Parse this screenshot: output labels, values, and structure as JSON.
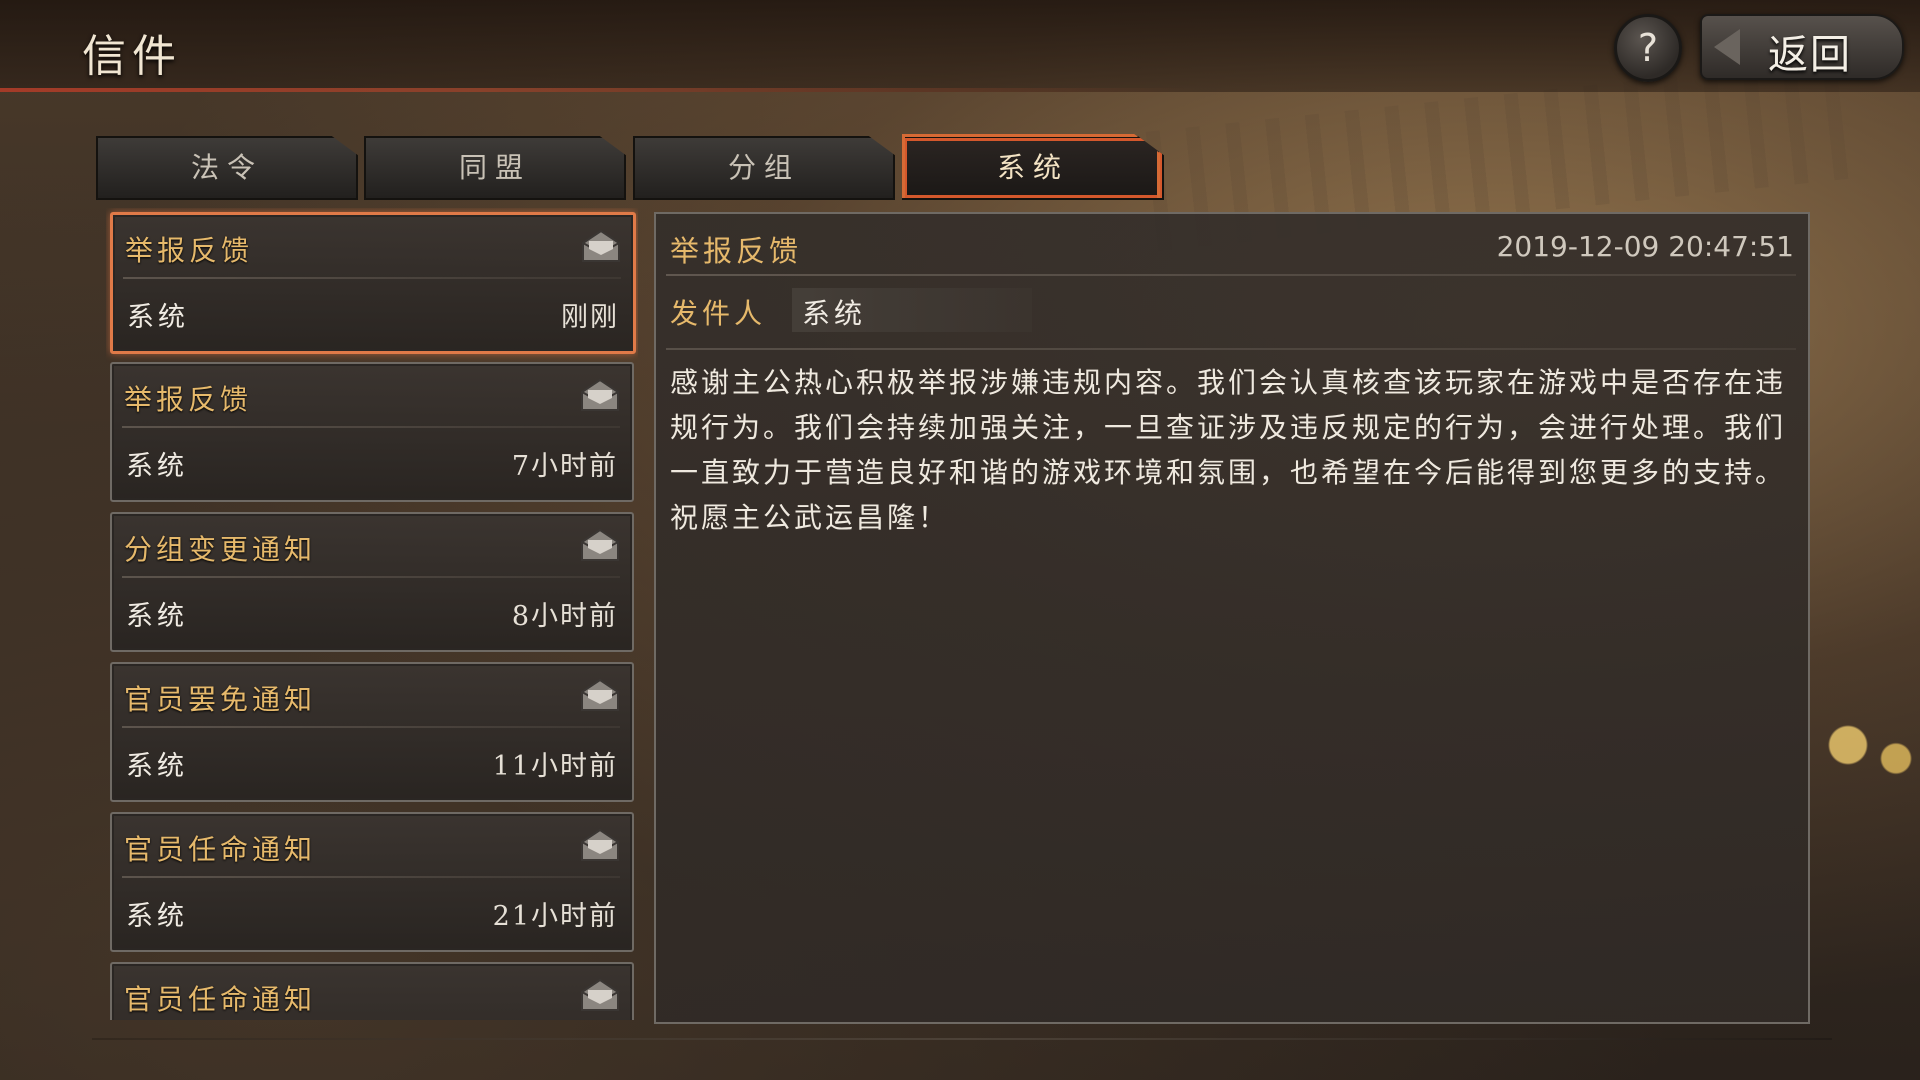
{
  "header": {
    "title": "信件",
    "help_label": "?",
    "back_label": "返回"
  },
  "tabs": [
    {
      "label": "法令",
      "active": false
    },
    {
      "label": "同盟",
      "active": false
    },
    {
      "label": "分组",
      "active": false
    },
    {
      "label": "系统",
      "active": true
    }
  ],
  "mail_list": [
    {
      "subject": "举报反馈",
      "sender": "系统",
      "time": "刚刚",
      "selected": true
    },
    {
      "subject": "举报反馈",
      "sender": "系统",
      "time": "7小时前",
      "selected": false
    },
    {
      "subject": "分组变更通知",
      "sender": "系统",
      "time": "8小时前",
      "selected": false
    },
    {
      "subject": "官员罢免通知",
      "sender": "系统",
      "time": "11小时前",
      "selected": false
    },
    {
      "subject": "官员任命通知",
      "sender": "系统",
      "time": "21小时前",
      "selected": false
    },
    {
      "subject": "官员任命通知",
      "sender": "",
      "time": "",
      "selected": false
    }
  ],
  "detail": {
    "title": "举报反馈",
    "date": "2019-12-09 20:47:51",
    "sender_label": "发件人",
    "sender": "系统",
    "body": "感谢主公热心积极举报涉嫌违规内容。我们会认真核查该玩家在游戏中是否存在违规行为。我们会持续加强关注，一旦查证涉及违反规定的行为，会进行处理。我们一直致力于营造良好和谐的游戏环境和氛围，也希望在今后能得到您更多的支持。祝愿主公武运昌隆！"
  },
  "colors": {
    "accent": "#e07a48",
    "gold_text": "#e6b96b",
    "header_red": "#aa3c28"
  }
}
